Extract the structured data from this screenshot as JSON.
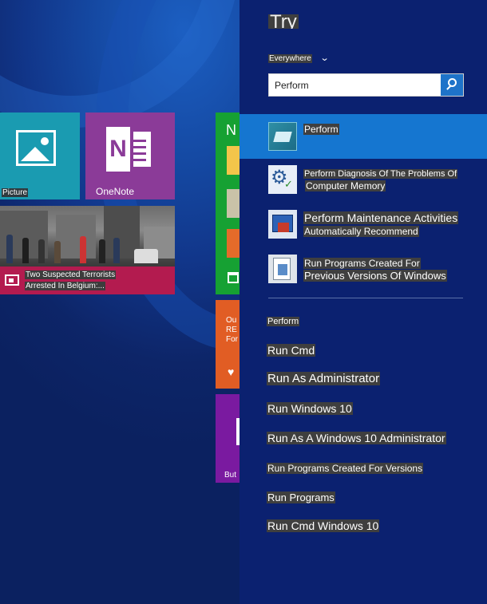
{
  "start_screen": {
    "tiles": {
      "pictures": {
        "label": "Picture"
      },
      "onenote": {
        "label": "OneNote"
      },
      "news": {
        "headline_line1": "Two Suspected Terrorists",
        "headline_line2": "Arrested In Belgium:..."
      },
      "green": {
        "letter": "N"
      },
      "orange": {
        "line1": "Ou",
        "line2": "RE",
        "line3": "For"
      },
      "purple": {
        "label": "But"
      }
    }
  },
  "search_charm": {
    "title": "Try",
    "scope": "Everywhere",
    "search": {
      "value": "Perform"
    },
    "results": [
      {
        "line1": "Perform",
        "line2": "",
        "icon": "perform-icon",
        "selected": true
      },
      {
        "line1": "Perform Diagnosis Of The Problems Of",
        "line2": "Computer Memory",
        "icon": "memory-diagnostic-icon",
        "selected": false
      },
      {
        "line1": "Perform Maintenance Activities",
        "line2": "Automatically Recommend",
        "icon": "maintenance-icon",
        "selected": false
      },
      {
        "line1": "Run Programs Created For",
        "line2": "Previous Versions Of Windows",
        "icon": "compatibility-icon",
        "selected": false
      }
    ],
    "suggestions_header": "Perform",
    "suggestions": [
      "Run Cmd",
      "Run As Administrator",
      "Run Windows 10",
      "Run As A Windows 10 Administrator",
      "Run Programs Created For Versions",
      "Run Programs",
      "Run Cmd Windows 10"
    ]
  },
  "colors": {
    "charm_bg": "#0b2170",
    "selected_result": "#1576d0",
    "search_button": "#1e73c9",
    "tile_pictures": "#1a9bb1",
    "tile_onenote": "#8b3b98",
    "tile_news": "#b31b4f",
    "tile_green": "#16a133",
    "tile_orange": "#e15d24",
    "tile_purple": "#7a1aa0"
  }
}
